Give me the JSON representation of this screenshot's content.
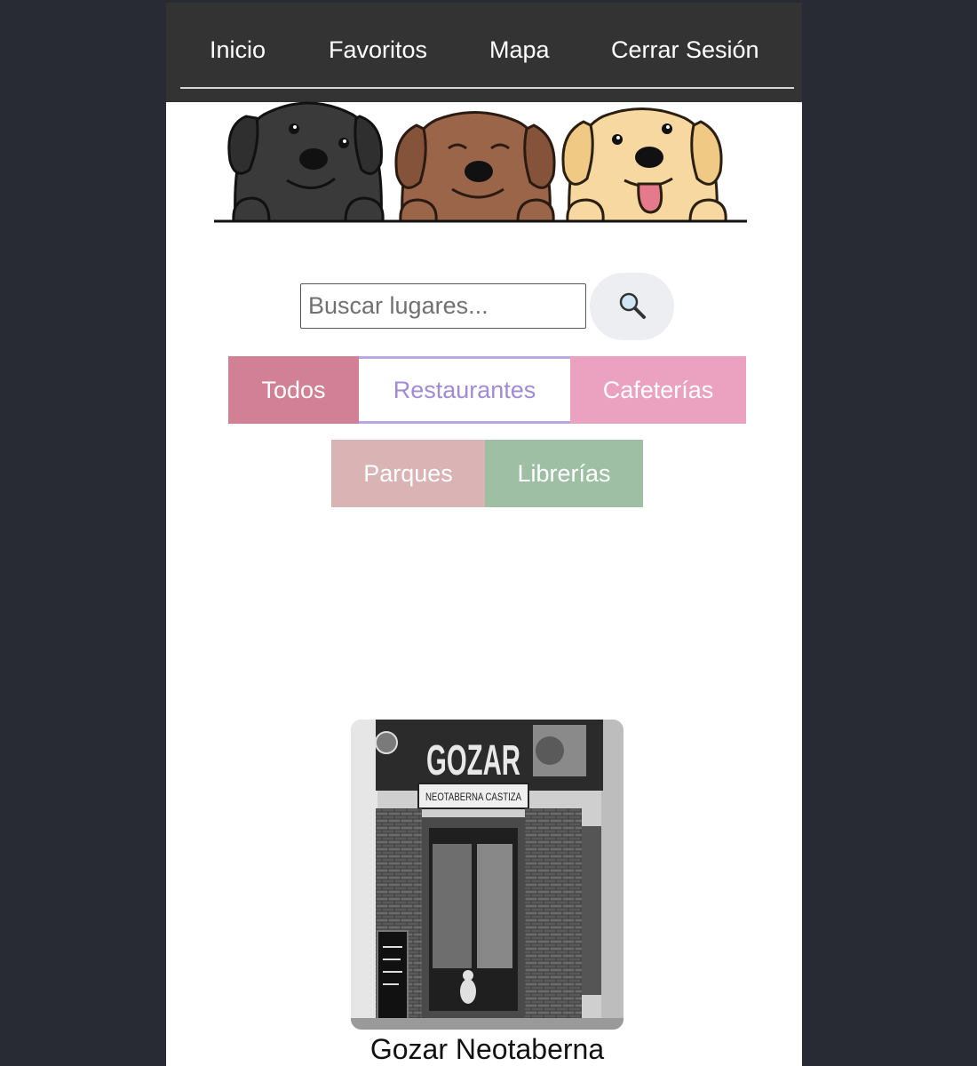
{
  "nav": {
    "items": [
      {
        "label": "Inicio"
      },
      {
        "label": "Favoritos"
      },
      {
        "label": "Mapa"
      },
      {
        "label": "Cerrar Sesión"
      }
    ]
  },
  "search": {
    "placeholder": "Buscar lugares...",
    "value": "",
    "button_icon": "search-icon"
  },
  "filters": [
    {
      "label": "Todos",
      "color": "#d18096"
    },
    {
      "label": "Restaurantes",
      "color": "#a18ad6",
      "active": true
    },
    {
      "label": "Cafeterías",
      "color": "#eaa2c0"
    },
    {
      "label": "Parques",
      "color": "#dab3b4"
    },
    {
      "label": "Librerías",
      "color": "#9fbfa5"
    }
  ],
  "place": {
    "name": "Gozar Neotaberna",
    "sign_title": "GOZAR",
    "sign_subtitle": "NEOTABERNA CASTIZA"
  },
  "colors": {
    "page_bg": "#292b34",
    "nav_bg": "#333333",
    "content_bg": "#ffffff"
  }
}
